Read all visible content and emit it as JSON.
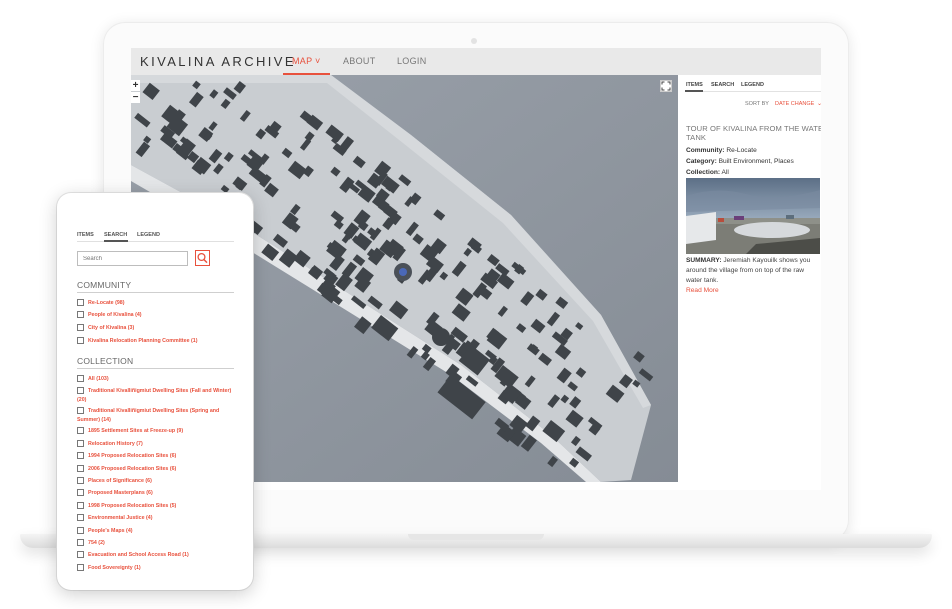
{
  "header": {
    "brand": "KIVALINA ARCHIVE",
    "nav": [
      {
        "label": "MAP ˅",
        "active": true
      },
      {
        "label": "ABOUT",
        "active": false
      },
      {
        "label": "LOGIN",
        "active": false
      }
    ]
  },
  "map": {
    "zoom_in": "+",
    "zoom_out": "−"
  },
  "panel": {
    "tabs": [
      "ITEMS",
      "SEARCH",
      "LEGEND"
    ],
    "active_tab": "ITEMS",
    "sort_label": "SORT BY",
    "sort_value": "DATE CHANGE",
    "item": {
      "title_line1": "TOUR OF KIVALINA FROM THE WATER",
      "title_line2": "TANK",
      "community_label": "Community:",
      "community_value": "Re-Locate",
      "category_label": "Category:",
      "category_value": "Built Environment, Places",
      "collection_label": "Collection:",
      "collection_value": "All",
      "summary_label": "SUMMARY:",
      "summary_text": "Jeremiah Kayouilk shows you around the village from on top of the raw water tank.",
      "read_more": "Read More"
    }
  },
  "mobile": {
    "tabs": [
      "ITEMS",
      "SEARCH",
      "LEGEND"
    ],
    "active_tab": "SEARCH",
    "search_placeholder": "Search",
    "community_heading": "COMMUNITY",
    "community_items": [
      "Re-Locate (98)",
      "People of Kivalina (4)",
      "City of Kivalina (3)",
      "Kivalina Relocation Planning Committee (1)"
    ],
    "collection_heading": "COLLECTION",
    "collection_items": [
      "All (103)",
      "Traditional Kivalliñigmiut Dwelling Sites (Fall and Winter) (20)",
      "Traditional Kivalliñigmiut Dwelling Sites (Spring and Summer) (14)",
      "1895 Settlement Sites at Freeze-up (9)",
      "Relocation History (7)",
      "1994 Proposed Relocation Sites (6)",
      "2006 Proposed Relocation Sites (6)",
      "Places of Significance (6)",
      "Proposed Masterplans (6)",
      "1998 Proposed Relocation Sites (5)",
      "Environmental Justice (4)",
      "People's Maps (4)",
      "754 (2)",
      "Evacuation and School Access Road (1)",
      "Food Sovereignty (1)"
    ]
  }
}
